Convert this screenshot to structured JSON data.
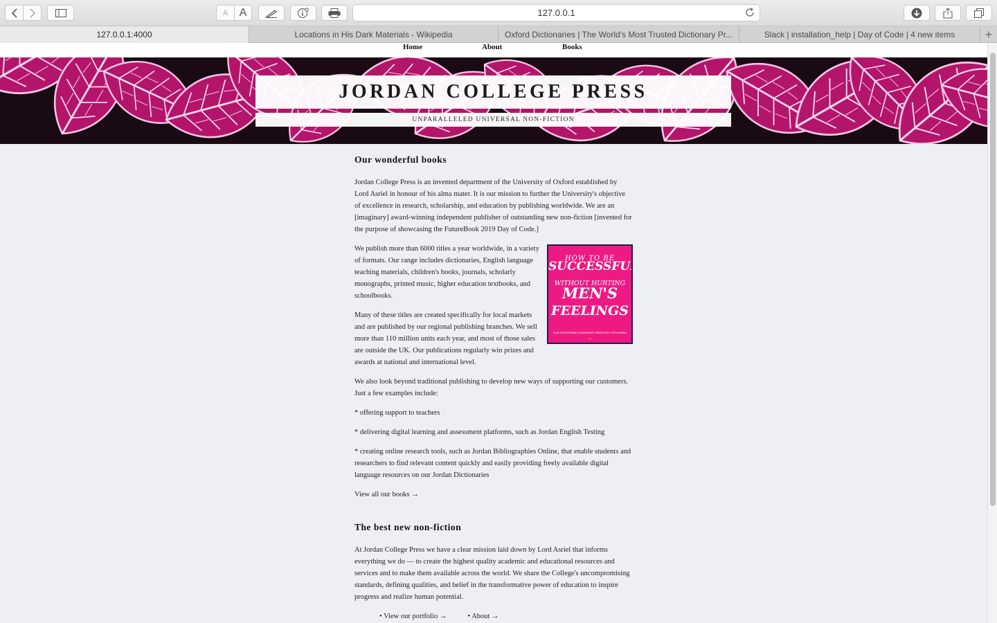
{
  "browser": {
    "url": "127.0.0.1",
    "text_size_small": "A",
    "text_size_large": "A",
    "tabs": [
      {
        "label": "127.0.0.1:4000",
        "active": true
      },
      {
        "label": "Locations in His Dark Materials - Wikipedia",
        "active": false
      },
      {
        "label": "Oxford Dictionaries | The World's Most Trusted Dictionary Pr...",
        "active": false
      },
      {
        "label": "Slack | installation_help | Day of Code | 4 new items",
        "active": false
      }
    ],
    "new_tab_label": "+"
  },
  "site": {
    "nav": {
      "home": "Home",
      "about": "About",
      "books": "Books"
    },
    "title": "JORDAN COLLEGE PRESS",
    "subtitle": "UNPARALLELED UNIVERSAL NON-FICTION",
    "hero_colors": {
      "background": "#1a0a14",
      "leaf": "#e0218a",
      "vein": "#f3c1e0"
    }
  },
  "main": {
    "section1_heading": "Our wonderful books",
    "para1": "Jordan College Press is an invented department of the University of Oxford established by Lord Asriel in honour of his alma mater. It is our mission to further the University's objective of excellence in research, scholarship, and education by publishing worldwide. We are an [imaginary] award-winning independent publisher of outstanding new non-fiction [invented for the purpose of showcasing the FutureBook 2019 Day of Code.]",
    "para2": "We publish more than 6000 titles a year worldwide, in a variety of formats. Our range includes dictionaries, English language teaching materials, children's books, journals, scholarly monographs, printed music, higher education textbooks, and schoolbooks.",
    "para3": "Many of these titles are created specifically for local markets and are published by our regional publishing branches. We sell more than 110 million units each year, and most of those sales are outside the UK. Our publications regularly win prizes and awards at national and international level.",
    "para4": "We also look beyond traditional publishing to develop new ways of supporting our customers. Just a few examples include:",
    "bullets": [
      "* offering support to teachers",
      "* delivering digital learning and assessment platforms, such as Jordan English Testing",
      "* creating online research tools, such as Jordan Bibliographies Online, that enable students and researchers to find relevant content quickly and easily providing freely available digital language resources on our Jordan Dictionaries"
    ],
    "view_books_link": "View all our books →",
    "book_cover": {
      "line1": "HOW TO BE",
      "line2": "SUCCESSFUL",
      "line3": "WITHOUT HURTING",
      "line4": "MEN'S",
      "line5": "FEELINGS",
      "tagline": "NON-THREATENING LEADERSHIP STRATEGIES FOR WOMEN",
      "background": "#ee1a83"
    },
    "section2_heading": "The best new non-fiction",
    "para5": "At Jordan College Press we have a clear mission laid down by Lord Asriel that informs everything we do — to create the highest quality academic and educational resources and services and to make them available across the world. We share the College's uncompromising standards, defining qualities, and belief in the transformative power of education to inspire progress and realize human potential.",
    "footer_links": [
      "• View our portfolio →",
      "• About →"
    ]
  }
}
